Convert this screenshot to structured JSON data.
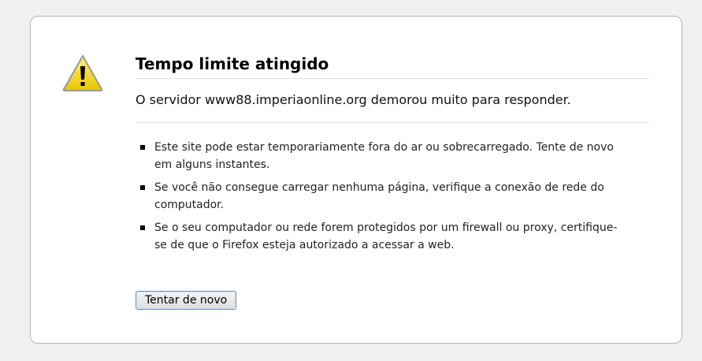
{
  "error": {
    "title": "Tempo limite atingido",
    "subtitle": "O servidor www88.imperiaonline.org demorou muito para responder.",
    "items": [
      "Este site pode estar temporariamente fora do ar ou sobrecarregado. Tente de novo em alguns instantes.",
      "Se você não consegue carregar nenhuma página, verifique a conexão de rede do computador.",
      "Se o seu computador ou rede forem protegidos por um firewall ou proxy, certifique-se de que o Firefox esteja autorizado a acessar a web."
    ],
    "retry_label": "Tentar de novo",
    "icon": "warning-icon"
  },
  "colors": {
    "warning_yellow": "#f5d90a",
    "page_background": "#f0f0f0"
  }
}
